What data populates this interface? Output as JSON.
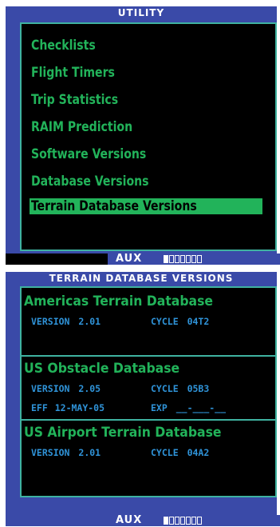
{
  "utility": {
    "title": "UTILITY",
    "menu": [
      {
        "label": "Checklists"
      },
      {
        "label": "Flight Timers"
      },
      {
        "label": "Trip Statistics"
      },
      {
        "label": "RAIM Prediction"
      },
      {
        "label": "Software Versions"
      },
      {
        "label": "Database Versions"
      },
      {
        "label": "Terrain Database Versions",
        "selected": true
      }
    ],
    "status": {
      "label": "AUX",
      "page_count": 7,
      "active_page": 1
    }
  },
  "terrain": {
    "title": "TERRAIN DATABASE VERSIONS",
    "databases": [
      {
        "name": "Americas Terrain Database",
        "version_label": "VERSION",
        "version": "2.01",
        "cycle_label": "CYCLE",
        "cycle": "04T2"
      },
      {
        "name": "US Obstacle Database",
        "version_label": "VERSION",
        "version": "2.05",
        "cycle_label": "CYCLE",
        "cycle": "05B3",
        "eff_label": "EFF",
        "eff": "12-MAY-05",
        "exp_label": "EXP",
        "exp": "__-___-__"
      },
      {
        "name": "US Airport Terrain Database",
        "version_label": "VERSION",
        "version": "2.01",
        "cycle_label": "CYCLE",
        "cycle": "04A2"
      }
    ],
    "status": {
      "label": "AUX",
      "page_count": 7,
      "active_page": 1
    }
  },
  "colors": {
    "frame": "#3a4aa8",
    "menu_text": "#22b35a",
    "value_text": "#2f93d8",
    "border": "#3fb2a0"
  }
}
